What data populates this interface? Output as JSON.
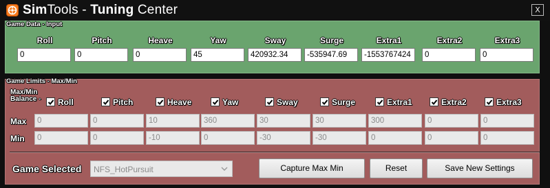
{
  "window": {
    "title_part1": "Sim",
    "title_part2": "Tools - ",
    "title_part3": "Tuning",
    "title_part4": " Center",
    "close_label": "X",
    "app_icon": "simtools-logo-icon"
  },
  "game_data": {
    "section_label": "Game Data - Input",
    "columns": [
      "Roll",
      "Pitch",
      "Heave",
      "Yaw",
      "Sway",
      "Surge",
      "Extra1",
      "Extra2",
      "Extra3"
    ],
    "values": [
      "0",
      "0",
      "0",
      "45",
      "420932.34",
      "-535947.69",
      "-1553767424",
      "0",
      "0"
    ]
  },
  "game_limits": {
    "section_label": "Game Limits - Max/Min",
    "balance_label_line1": "Max/Min",
    "balance_label_line2": "Balance -",
    "checkboxes": [
      {
        "label": "Roll",
        "checked": true
      },
      {
        "label": "Pitch",
        "checked": true
      },
      {
        "label": "Heave",
        "checked": true
      },
      {
        "label": "Yaw",
        "checked": true
      },
      {
        "label": "Sway",
        "checked": true
      },
      {
        "label": "Surge",
        "checked": true
      },
      {
        "label": "Extra1",
        "checked": true
      },
      {
        "label": "Extra2",
        "checked": true
      },
      {
        "label": "Extra3",
        "checked": true
      }
    ],
    "max_label": "Max",
    "min_label": "Min",
    "max_values": [
      "0",
      "0",
      "10",
      "360",
      "30",
      "30",
      "300",
      "0",
      "0"
    ],
    "min_values": [
      "0",
      "0",
      "-10",
      "0",
      "-30",
      "-30",
      "0",
      "0",
      "0"
    ]
  },
  "footer": {
    "game_selected_label": "Game Selected",
    "game_selected_value": "NFS_HotPursuit",
    "capture_button": "Capture Max Min",
    "reset_button": "Reset",
    "save_button": "Save New Settings"
  },
  "colors": {
    "titlebar": "#111111",
    "input_panel": "#6aa46e",
    "limits_panel": "#a25c5c",
    "accent": "#f57a1c"
  }
}
